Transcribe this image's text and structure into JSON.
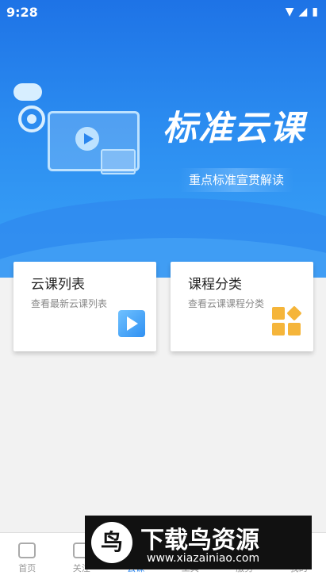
{
  "status_bar": {
    "time": "9:28",
    "wifi_icon": "wifi-icon",
    "signal_icon": "signal-icon",
    "battery_icon": "battery-icon"
  },
  "banner": {
    "title": "标准云课",
    "subtitle": "重点标准宣贯解读"
  },
  "cards": [
    {
      "title": "云课列表",
      "desc": "查看最新云课列表",
      "icon": "play-icon"
    },
    {
      "title": "课程分类",
      "desc": "查看云课课程分类",
      "icon": "category-grid-icon"
    }
  ],
  "tabbar": {
    "items": [
      {
        "label": "首页",
        "icon": "home-icon"
      },
      {
        "label": "关注",
        "icon": "broadcast-icon"
      },
      {
        "label": "云课",
        "icon": "cloud-class-icon",
        "active": true
      },
      {
        "label": "工具",
        "icon": "tool-icon"
      },
      {
        "label": "服务",
        "icon": "service-icon"
      },
      {
        "label": "我的",
        "icon": "user-icon"
      }
    ]
  },
  "watermark": {
    "logo": "",
    "text": "下载鸟资源",
    "url": "www.xiazainiao.com"
  },
  "colors": {
    "primary": "#2a86ee",
    "accent": "#f5b53a"
  }
}
